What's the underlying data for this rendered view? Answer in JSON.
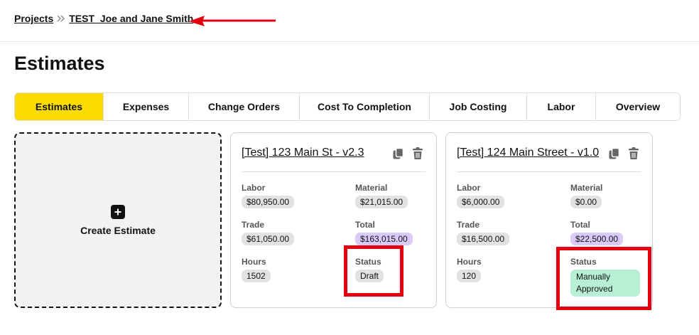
{
  "breadcrumb": {
    "items": [
      {
        "label": "Projects"
      },
      {
        "label": "TEST_Joe and Jane Smith"
      }
    ]
  },
  "page": {
    "title": "Estimates"
  },
  "tabs": [
    {
      "label": "Estimates",
      "active": true
    },
    {
      "label": "Expenses"
    },
    {
      "label": "Change Orders"
    },
    {
      "label": "Cost To Completion"
    },
    {
      "label": "Job Costing"
    },
    {
      "label": "Labor"
    },
    {
      "label": "Overview"
    }
  ],
  "create_card": {
    "label": "Create Estimate"
  },
  "estimates": [
    {
      "title": "[Test] 123 Main St - v2.3",
      "labor_label": "Labor",
      "labor": "$80,950.00",
      "material_label": "Material",
      "material": "$21,015.00",
      "trade_label": "Trade",
      "trade": "$61,050.00",
      "total_label": "Total",
      "total": "$163,015.00",
      "hours_label": "Hours",
      "hours": "1502",
      "status_label": "Status",
      "status": "Draft"
    },
    {
      "title": "[Test] 124 Main Street - v1.0",
      "labor_label": "Labor",
      "labor": "$6,000.00",
      "material_label": "Material",
      "material": "$0.00",
      "trade_label": "Trade",
      "trade": "$16,500.00",
      "total_label": "Total",
      "total": "$22,500.00",
      "hours_label": "Hours",
      "hours": "120",
      "status_label": "Status",
      "status": "Manually Approved"
    }
  ],
  "colors": {
    "accent": "#fbdc01",
    "annotation": "#e3000f",
    "total_pill": "#d9c9f9",
    "approved_pill": "#b8f0d6"
  }
}
